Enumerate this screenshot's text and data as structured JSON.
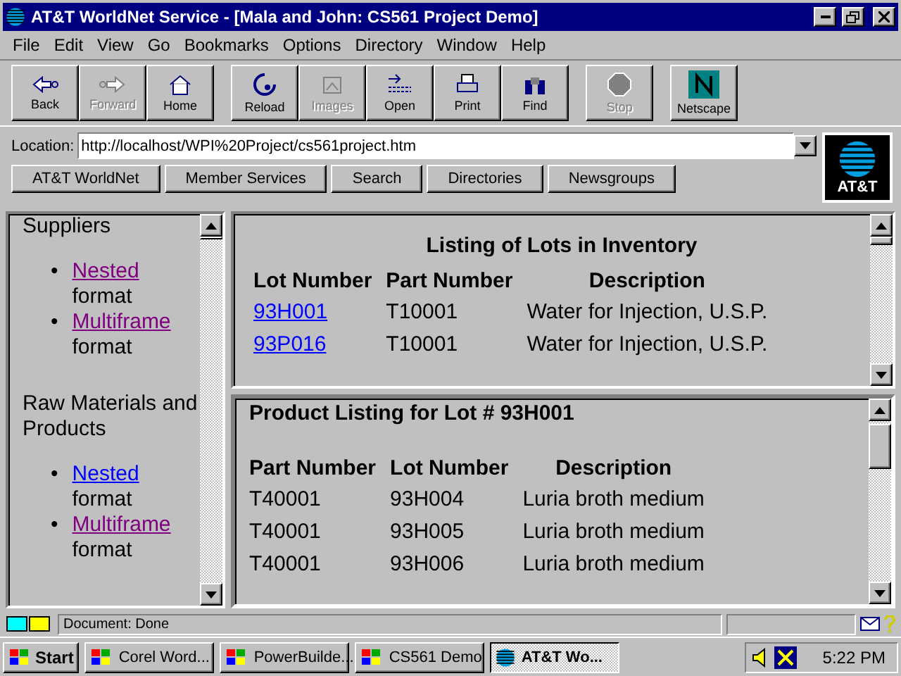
{
  "window": {
    "title": "AT&T WorldNet Service - [Mala and John: CS561 Project Demo]"
  },
  "menu": [
    "File",
    "Edit",
    "View",
    "Go",
    "Bookmarks",
    "Options",
    "Directory",
    "Window",
    "Help"
  ],
  "toolbar": [
    {
      "label": "Back",
      "disabled": false
    },
    {
      "label": "Forward",
      "disabled": true
    },
    {
      "label": "Home",
      "disabled": false
    },
    {
      "label": "Reload",
      "disabled": false
    },
    {
      "label": "Images",
      "disabled": true
    },
    {
      "label": "Open",
      "disabled": false
    },
    {
      "label": "Print",
      "disabled": false
    },
    {
      "label": "Find",
      "disabled": false
    },
    {
      "label": "Stop",
      "disabled": true
    },
    {
      "label": "Netscape",
      "disabled": false
    }
  ],
  "location": {
    "label": "Location:",
    "value": "http://localhost/WPI%20Project/cs561project.htm"
  },
  "directory_buttons": [
    "AT&T WorldNet",
    "Member Services",
    "Search",
    "Directories",
    "Newsgroups"
  ],
  "logo": {
    "text": "AT&T"
  },
  "nav_frame": {
    "sections": [
      {
        "heading": "Suppliers",
        "links": [
          {
            "bullet": "•",
            "link": "Nested",
            "suffix": "format",
            "visited": true
          },
          {
            "bullet": "•",
            "link": "Multiframe",
            "suffix": "format",
            "visited": true
          }
        ]
      },
      {
        "heading": "Raw Materials and Products",
        "links": [
          {
            "bullet": "•",
            "link": "Nested",
            "suffix": "format",
            "visited": false
          },
          {
            "bullet": "•",
            "link": "Multiframe",
            "suffix": "format",
            "visited": true
          }
        ]
      }
    ]
  },
  "lots_frame": {
    "title": "Listing of Lots in Inventory",
    "columns": [
      "Lot Number",
      "Part Number",
      "Description"
    ],
    "rows": [
      [
        "93H001",
        "T10001",
        "Water for Injection, U.S.P."
      ],
      [
        "93P016",
        "T10001",
        "Water for Injection, U.S.P."
      ]
    ]
  },
  "products_frame": {
    "title": "Product Listing for Lot # 93H001",
    "columns": [
      "Part Number",
      "Lot Number",
      "Description"
    ],
    "rows": [
      [
        "T40001",
        "93H004",
        "Luria broth medium"
      ],
      [
        "T40001",
        "93H005",
        "Luria broth medium"
      ],
      [
        "T40001",
        "93H006",
        "Luria broth medium"
      ]
    ]
  },
  "status_bar": {
    "text": "Document: Done"
  },
  "taskbar": {
    "start": "Start",
    "tasks": [
      {
        "label": "Corel Word...",
        "selected": false
      },
      {
        "label": "PowerBuilde...",
        "selected": false
      },
      {
        "label": "CS561 Demo",
        "selected": false
      },
      {
        "label": "AT&T Wo...",
        "selected": true
      }
    ],
    "clock": "5:22 PM"
  }
}
